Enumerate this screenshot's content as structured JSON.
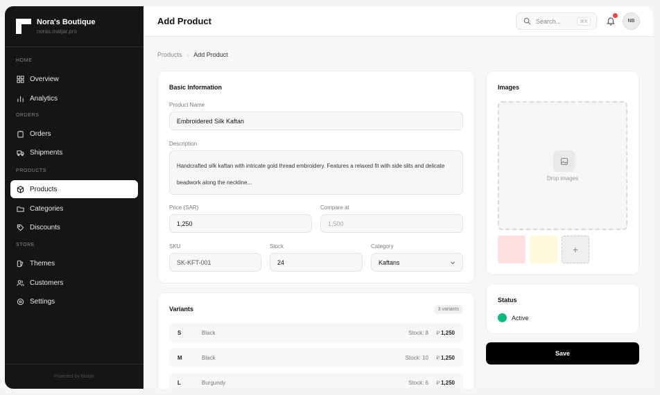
{
  "brand": {
    "name": "Nora's Boutique",
    "url": "noras.matjar.pro"
  },
  "sidebar": {
    "groups": [
      {
        "label": "HOME",
        "items": [
          {
            "label": "Overview",
            "icon": "grid-icon"
          },
          {
            "label": "Analytics",
            "icon": "bar-chart-icon"
          }
        ]
      },
      {
        "label": "ORDERS",
        "items": [
          {
            "label": "Orders",
            "icon": "clipboard-icon"
          },
          {
            "label": "Shipments",
            "icon": "truck-icon"
          }
        ]
      },
      {
        "label": "PRODUCTS",
        "items": [
          {
            "label": "Products",
            "icon": "box-icon",
            "active": true
          },
          {
            "label": "Categories",
            "icon": "folder-icon"
          },
          {
            "label": "Discounts",
            "icon": "tag-icon"
          }
        ]
      },
      {
        "label": "STORE",
        "items": [
          {
            "label": "Themes",
            "icon": "palette-icon"
          },
          {
            "label": "Customers",
            "icon": "users-icon"
          },
          {
            "label": "Settings",
            "icon": "gear-icon"
          }
        ]
      }
    ],
    "footer": "Powered by Matjar"
  },
  "header": {
    "title": "Add Product",
    "search_placeholder": "Search...",
    "search_shortcut": "⌘K",
    "avatar_initials": "NB"
  },
  "breadcrumb": {
    "parent": "Products",
    "current": "Add Product"
  },
  "basic_info": {
    "title": "Basic Information",
    "name_label": "Product Name",
    "name_value": "Embroidered Silk Kaftan",
    "description_label": "Description",
    "description_value": "Handcrafted silk kaftan with intricate gold thread embroidery. Features a relaxed fit with side slits and delicate beadwork along the neckline...",
    "price_label": "Price (SAR)",
    "price_value": "1,250",
    "compare_label": "Compare at",
    "compare_placeholder": "1,500",
    "sku_label": "SKU",
    "sku_placeholder": "SK-KFT-001",
    "stock_label": "Stock",
    "stock_value": "24",
    "category_label": "Category",
    "category_value": "Kaftans"
  },
  "images": {
    "title": "Images",
    "drop_text": "Drop images",
    "thumb_colors": [
      "#ffe0e0",
      "#fff9db"
    ],
    "add_symbol": "+"
  },
  "status": {
    "title": "Status",
    "value": "Active",
    "color": "#10b981"
  },
  "save_label": "Save",
  "variants": {
    "title": "Variants",
    "count_label": "3 variants",
    "currency_symbol": "⃁",
    "rows": [
      {
        "size": "S",
        "color": "Black",
        "stock": "Stock: 8",
        "price": "1,250"
      },
      {
        "size": "M",
        "color": "Black",
        "stock": "Stock: 10",
        "price": "1,250"
      },
      {
        "size": "L",
        "color": "Burgundy",
        "stock": "Stock: 6",
        "price": "1,250"
      }
    ]
  }
}
